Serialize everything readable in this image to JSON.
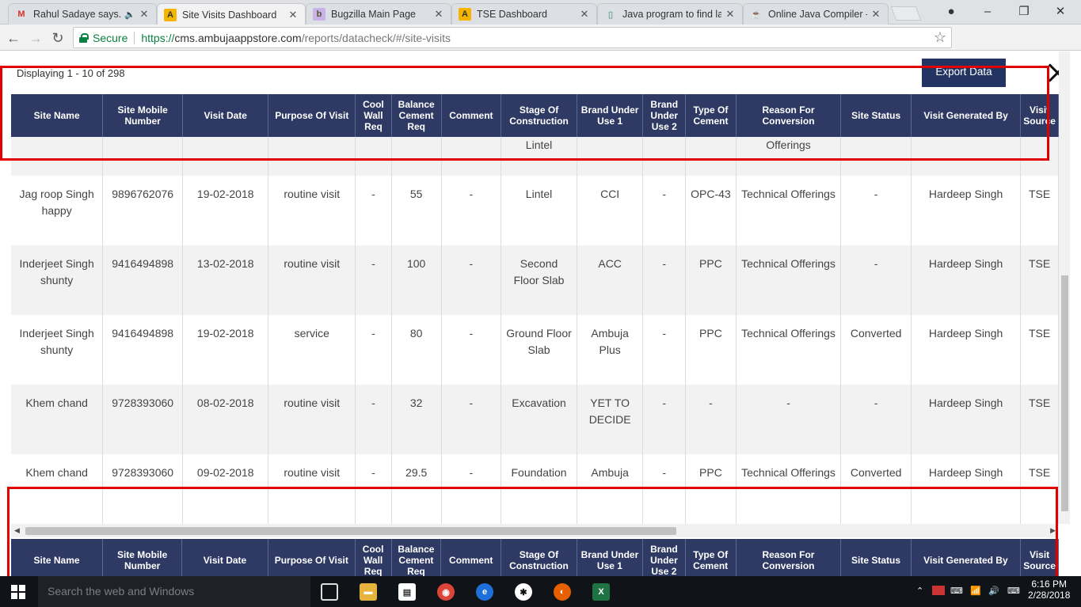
{
  "browser": {
    "tabs": [
      {
        "title": "Rahul Sadaye says...",
        "icon": "gmail-icon",
        "audio": true
      },
      {
        "title": "Site Visits Dashboard",
        "icon": "ambuja-icon",
        "active": true
      },
      {
        "title": "Bugzilla Main Page",
        "icon": "bugzilla-icon"
      },
      {
        "title": "TSE Dashboard",
        "icon": "ambuja-icon"
      },
      {
        "title": "Java program to find la",
        "icon": "page-icon"
      },
      {
        "title": "Online Java Compiler -",
        "icon": "java-icon"
      }
    ],
    "secure_label": "Secure",
    "url_proto": "https://",
    "url_host": "cms.ambujaappstore.com",
    "url_path": "/reports/datacheck/#/site-visits"
  },
  "page": {
    "displaying": "Displaying 1 - 10 of 298",
    "export_label": "Export Data"
  },
  "table": {
    "headers": [
      "Site Name",
      "Site Mobile Number",
      "Visit Date",
      "Purpose Of Visit",
      "Cool Wall Req",
      "Balance Cement Req",
      "Comment",
      "Stage Of Construction",
      "Brand Under Use 1",
      "Brand Under Use 2",
      "Type Of Cement",
      "Reason For Conversion",
      "Site Status",
      "Visit Generated By",
      "Visit Source"
    ],
    "partial_top_row": [
      "",
      "",
      "",
      "",
      "",
      "",
      "",
      "Lintel",
      "",
      "",
      "",
      "Offerings",
      "",
      "",
      ""
    ],
    "rows": [
      [
        "Jag roop Singh happy",
        "9896762076",
        "19-02-2018",
        "routine visit",
        "-",
        "55",
        "-",
        "Lintel",
        "CCI",
        "-",
        "OPC-43",
        "Technical Offerings",
        "-",
        "Hardeep Singh",
        "TSE"
      ],
      [
        "Inderjeet Singh shunty",
        "9416494898",
        "13-02-2018",
        "routine visit",
        "-",
        "100",
        "-",
        "Second Floor Slab",
        "ACC",
        "-",
        "PPC",
        "Technical Offerings",
        "-",
        "Hardeep Singh",
        "TSE"
      ],
      [
        "Inderjeet Singh shunty",
        "9416494898",
        "19-02-2018",
        "service",
        "-",
        "80",
        "-",
        "Ground Floor Slab",
        "Ambuja Plus",
        "-",
        "PPC",
        "Technical Offerings",
        "Converted",
        "Hardeep Singh",
        "TSE"
      ],
      [
        "Khem chand",
        "9728393060",
        "08-02-2018",
        "routine visit",
        "-",
        "32",
        "-",
        "Excavation",
        "YET TO DECIDE",
        "-",
        "-",
        "-",
        "-",
        "Hardeep Singh",
        "TSE"
      ],
      [
        "Khem chand",
        "9728393060",
        "09-02-2018",
        "routine visit",
        "-",
        "29.5",
        "-",
        "Foundation",
        "Ambuja",
        "-",
        "PPC",
        "Technical Offerings",
        "Converted",
        "Hardeep Singh",
        "TSE"
      ]
    ]
  },
  "taskbar": {
    "search_placeholder": "Search the web and Windows",
    "time": "6:16 PM",
    "date": "2/28/2018"
  },
  "colors": {
    "header_bg": "#2e3a63",
    "export_bg": "#243462",
    "annotation": "#e00000"
  }
}
